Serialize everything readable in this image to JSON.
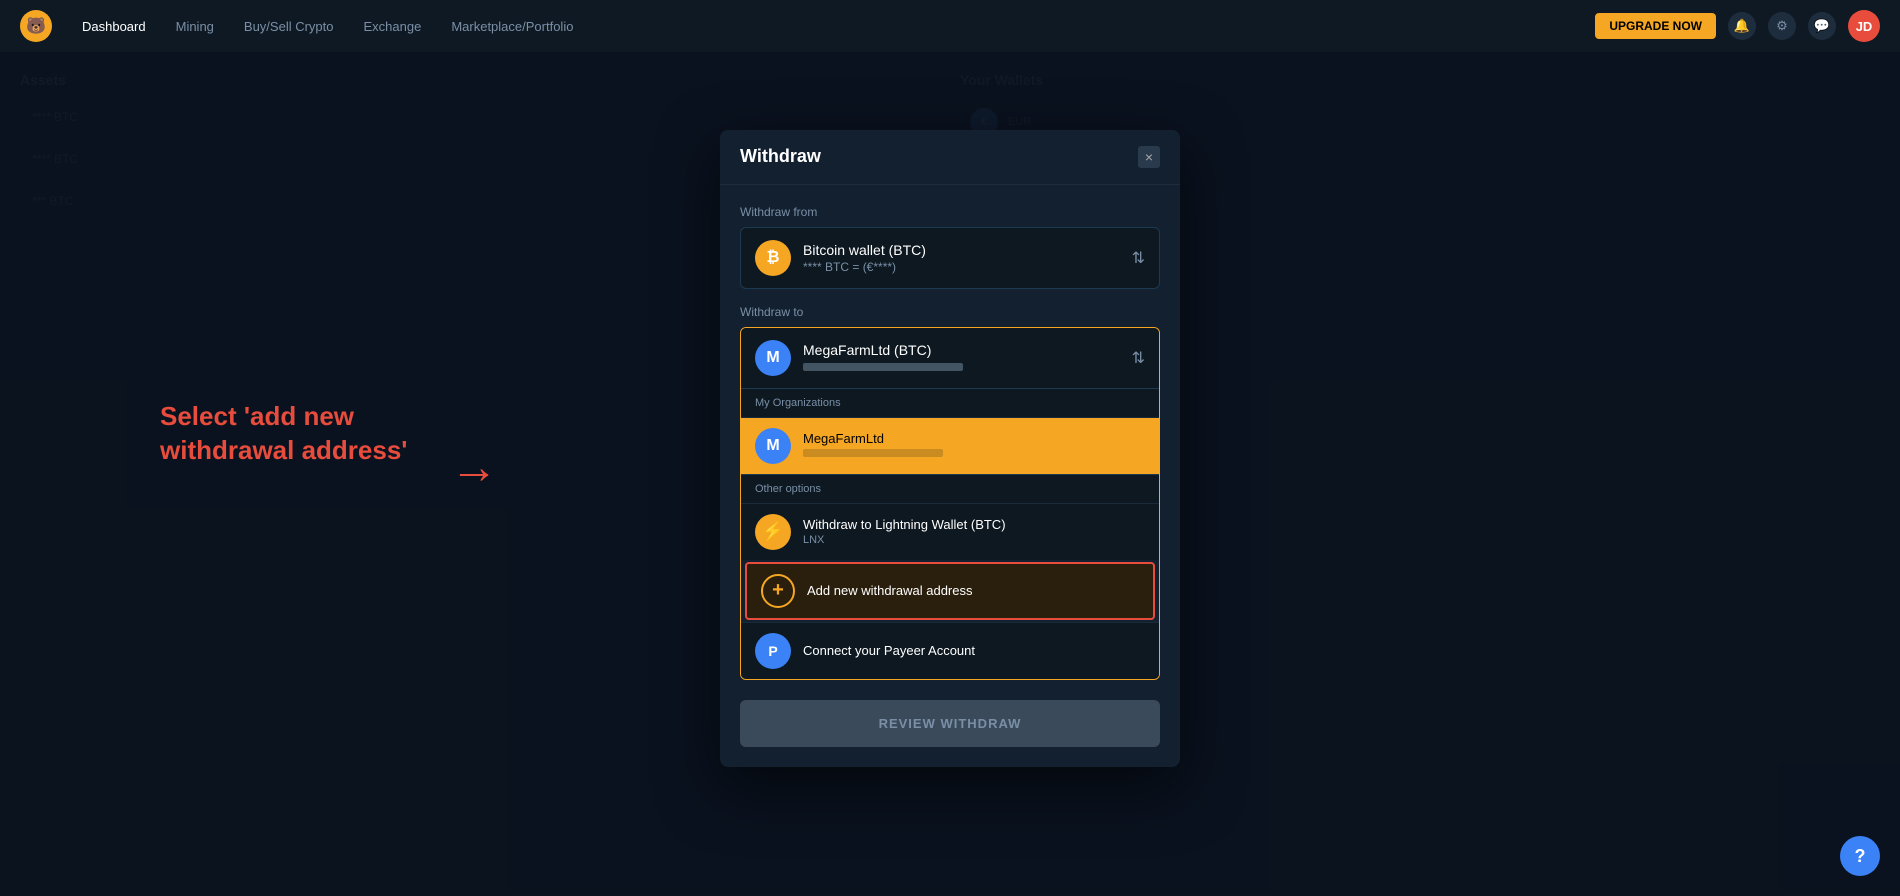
{
  "topnav": {
    "logo": "🐻",
    "links": [
      "Dashboard",
      "Mining",
      "Buy/Sell Crypto",
      "Exchange",
      "Marketplace/Portfolio"
    ],
    "cta_label": "UPGRADE NOW",
    "avatar_initials": "JD"
  },
  "modal": {
    "title": "Withdraw",
    "close_label": "×",
    "withdraw_from_label": "Withdraw from",
    "wallet_name": "Bitcoin wallet (BTC)",
    "wallet_balance": "**** BTC = (€****)",
    "btc_symbol": "₿",
    "withdraw_to_label": "Withdraw to",
    "selected_org_name": "MegaFarmLtd (BTC)",
    "my_organizations_label": "My Organizations",
    "other_options_label": "Other options",
    "organizations": [
      {
        "name": "MegaFarmLtd",
        "address": "━━━━━━━━━━━━━━━━━━━━━━━━",
        "selected": true
      }
    ],
    "other_options": [
      {
        "name": "Withdraw to Lightning Wallet (BTC)",
        "sub": "LNX",
        "icon_type": "lightning"
      },
      {
        "name": "Add new withdrawal address",
        "sub": "",
        "icon_type": "add",
        "highlighted": true
      },
      {
        "name": "Connect your Payeer Account",
        "sub": "",
        "icon_type": "payeer"
      }
    ],
    "review_btn_label": "REVIEW WITHDRAW"
  },
  "annotation": {
    "text": "Select 'add new withdrawal address'",
    "arrow": "→"
  },
  "help": {
    "label": "?"
  }
}
